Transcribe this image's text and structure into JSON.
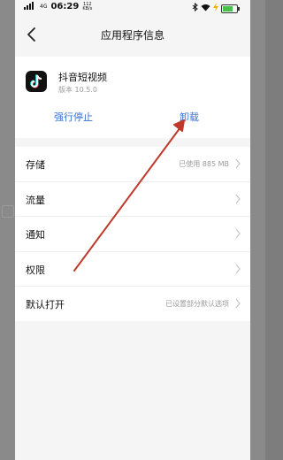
{
  "status_bar": {
    "signal_label": "4G",
    "time": "06:29",
    "rate_value": "112",
    "rate_unit": "KB/s"
  },
  "header": {
    "title": "应用程序信息",
    "back_icon": "chevron-left-icon"
  },
  "app": {
    "name": "抖音短视频",
    "version": "版本 10.5.0",
    "icon": "tiktok-icon"
  },
  "actions": {
    "force_stop": "强行停止",
    "uninstall": "卸载"
  },
  "settings": {
    "items": [
      {
        "label": "存储",
        "value": "已使用 885 MB"
      },
      {
        "label": "流量",
        "value": ""
      },
      {
        "label": "通知",
        "value": ""
      },
      {
        "label": "权限",
        "value": ""
      },
      {
        "label": "默认打开",
        "value": "已设置部分默认选项"
      }
    ]
  },
  "colors": {
    "link": "#3a72d6",
    "annotation_arrow": "#c0392b",
    "battery": "#46c24a"
  }
}
